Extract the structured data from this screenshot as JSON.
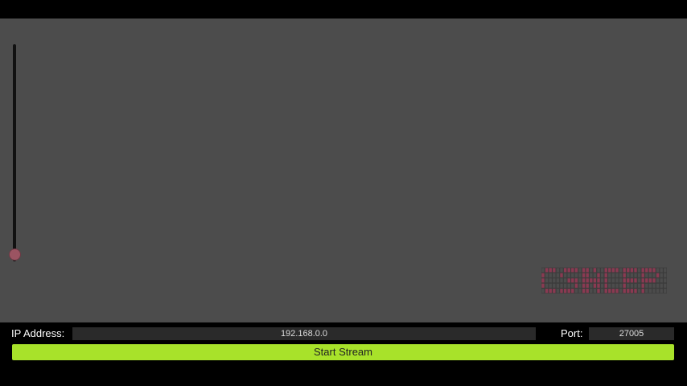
{
  "stream": {
    "ip_label": "IP Address:",
    "ip_value": "192.168.0.0",
    "port_label": "Port:",
    "port_value": "27005",
    "start_label": "Start Stream"
  },
  "slider": {
    "level": 0.12
  },
  "colors": {
    "accent": "#a8e22a",
    "viewport": "#4c4c4c",
    "thumb": "#9b5462",
    "logo_on": "#8a3a52",
    "logo_grid": "#3a3a3a"
  },
  "logo": {
    "name": "pixel-grid-logo",
    "rows": [
      "0111001111011010011110111101111000",
      "1000010000011001010000100001000100",
      "1000000111011111010000111101111000",
      "1000000001011011010000100001000000",
      "0111011110011001011110111101000000"
    ]
  }
}
